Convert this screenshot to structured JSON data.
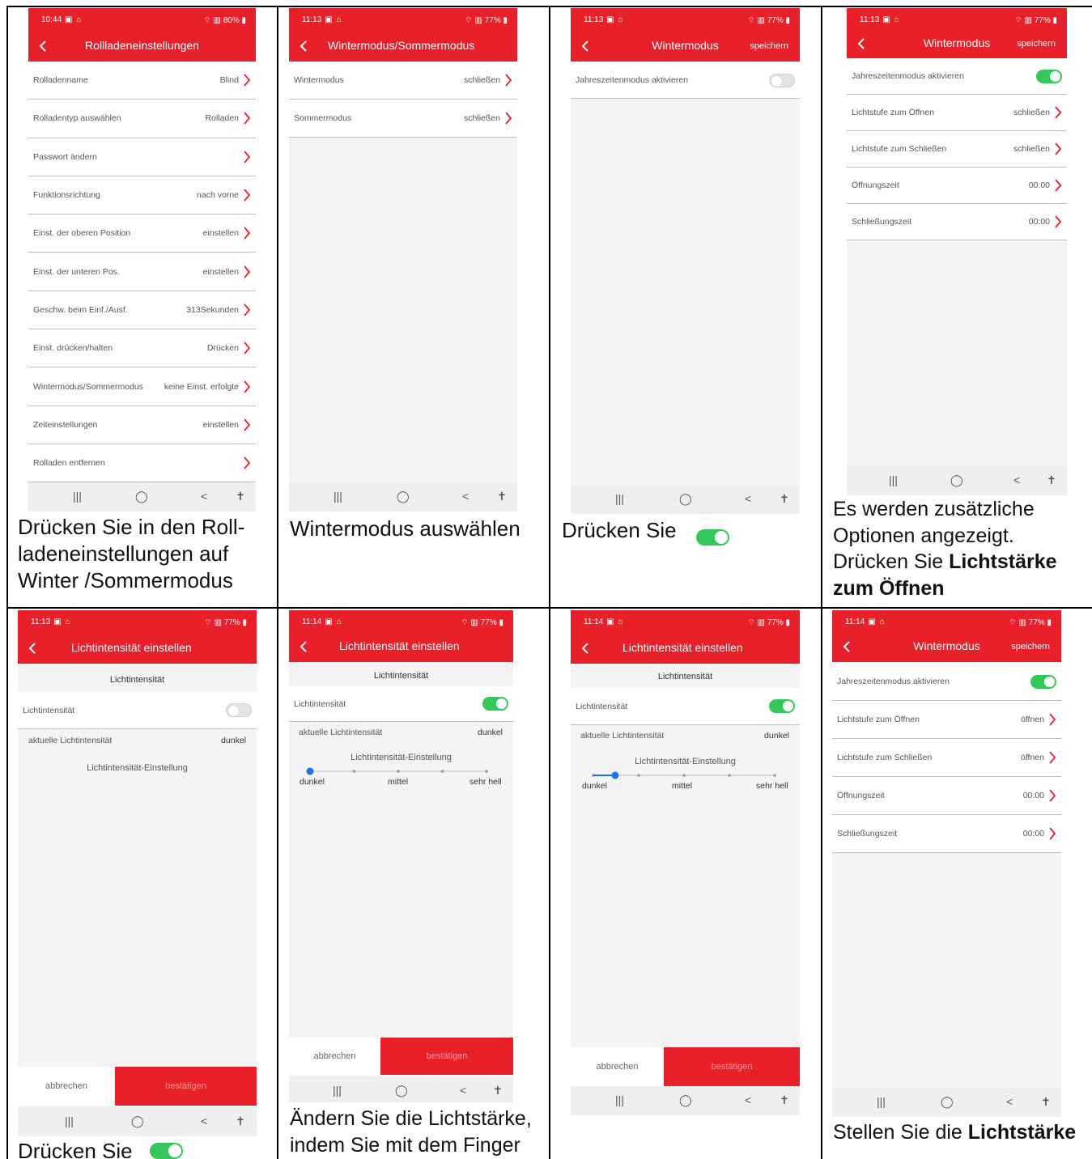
{
  "status": {
    "p1_time": "10:44",
    "p1_batt": "80%",
    "time_1113": "11:13",
    "time_1114": "11:14",
    "batt": "77%"
  },
  "panel1": {
    "title": "Rollladeneinstellungen",
    "rows": [
      {
        "label": "Rolladenname",
        "value": "Blind"
      },
      {
        "label": "Rolladentyp auswählen",
        "value": "Rolladen"
      },
      {
        "label": "Passwort ändern",
        "value": ""
      },
      {
        "label": "Funktionsrichtung",
        "value": "nach vorne"
      },
      {
        "label": "Einst. der oberen Position",
        "value": "einstellen"
      },
      {
        "label": "Einst. der unteren Pos.",
        "value": "einstellen"
      },
      {
        "label": "Geschw. beim Einf./Ausf.",
        "value": "313Sekunden"
      },
      {
        "label": "Einst. drücken/halten",
        "value": "Drücken"
      },
      {
        "label": "Wintermodus/Sommermodus",
        "value": "keine Einst. erfolgte"
      },
      {
        "label": "Zeiteinstellungen",
        "value": "einstellen"
      },
      {
        "label": "Rolladen entfernen",
        "value": ""
      }
    ],
    "caption": "Drücken Sie in den Roll-ladeneinstellungen auf Winter /Sommermodus"
  },
  "panel2": {
    "title": "Wintermodus/Sommermodus",
    "rows": [
      {
        "label": "Wintermodus",
        "value": "schließen"
      },
      {
        "label": "Sommermodus",
        "value": "schließen"
      }
    ],
    "caption": "Wintermodus auswählen"
  },
  "panel3": {
    "title": "Wintermodus",
    "save": "speichern",
    "row_label": "Jahreszeitenmodus aktivieren",
    "caption": "Drücken Sie"
  },
  "panel4": {
    "title": "Wintermodus",
    "save": "speichern",
    "rows": [
      {
        "label": "Jahreszeitenmodus aktivieren",
        "value": ""
      },
      {
        "label": "Lichtstufe zum Öffnen",
        "value": "schließen"
      },
      {
        "label": "Lichtstufe zum Schließen",
        "value": "schließen"
      },
      {
        "label": "Öffnungszeit",
        "value": "00:00"
      },
      {
        "label": "Schließungszeit",
        "value": "00:00"
      }
    ],
    "caption_normal": "Es werden zusätzliche Optionen angezeigt. Drücken Sie",
    "caption_bold": "Lichtstärke zum Öffnen"
  },
  "light": {
    "title": "Lichtintensität einstellen",
    "header": "Lichtintensität",
    "toggle_label": "Lichtintensität",
    "current_label": "aktuelle Lichtintensität",
    "current_value": "dunkel",
    "setting_label": "Lichtintensität-Einstellung",
    "slider_labels": [
      "dunkel",
      "mittel",
      "sehr hell"
    ],
    "cancel": "abbrechen",
    "confirm": "bestätigen"
  },
  "panel5": {
    "caption": "Drücken Sie"
  },
  "panel6": {
    "caption": "Ändern Sie die Lichtstärke, indem Sie mit dem Finger",
    "slider_position": 0
  },
  "panel7": {
    "slider_position": 0.12
  },
  "panel8": {
    "title": "Wintermodus",
    "save": "speichern",
    "rows": [
      {
        "label": "Jahreszeitenmodus aktivieren",
        "value": ""
      },
      {
        "label": "Lichtstufe zum Öffnen",
        "value": "öffnen"
      },
      {
        "label": "Lichtstufe zum Schließen",
        "value": "öffnen"
      },
      {
        "label": "Öffnungszeit",
        "value": "00:00"
      },
      {
        "label": "Schließungszeit",
        "value": "00:00"
      }
    ],
    "caption_normal": "Stellen Sie die",
    "caption_bold": "Lichtstärke"
  },
  "navbar": {
    "recent": "|||",
    "home": "◯",
    "back": "<",
    "access": "✝"
  },
  "colors": {
    "accent": "#e8202a",
    "toggle_on": "#34c759",
    "slider": "#1a73e8"
  }
}
